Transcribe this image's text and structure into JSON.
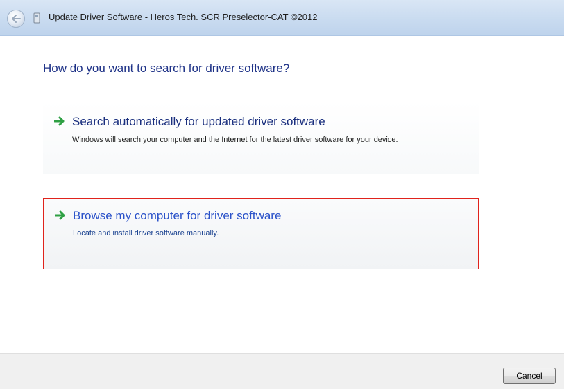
{
  "window": {
    "title": "Update Driver Software - Heros Tech. SCR Preselector-CAT ©2012"
  },
  "main": {
    "heading": "How do you want to search for driver software?",
    "options": [
      {
        "title": "Search automatically for updated driver software",
        "description": "Windows will search your computer and the Internet for the latest driver software for your device.",
        "icon": "green-arrow-icon",
        "highlighted": false
      },
      {
        "title": "Browse my computer for driver software",
        "description": "Locate and install driver software manually.",
        "icon": "green-arrow-icon",
        "highlighted": true
      }
    ]
  },
  "footer": {
    "cancel_label": "Cancel"
  },
  "colors": {
    "heading": "#1e3287",
    "link": "#2a52c9",
    "arrow": "#2ea043",
    "highlight_border": "#e0231c"
  }
}
